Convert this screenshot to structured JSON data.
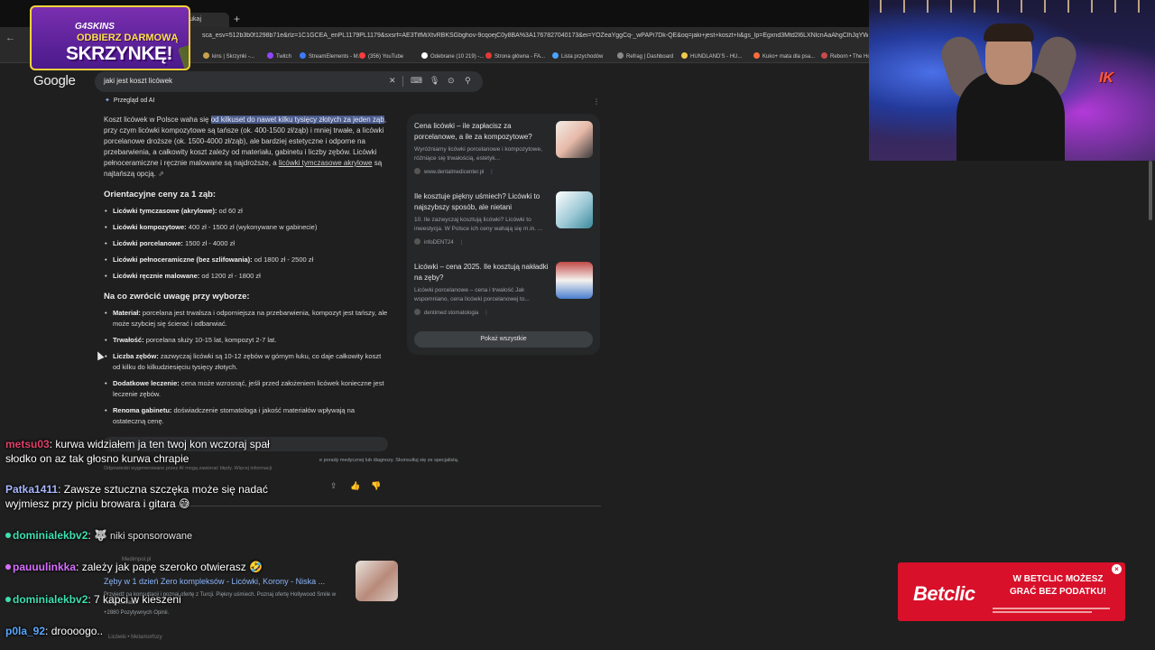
{
  "browser": {
    "tab_label": "Szukaj",
    "url": "sca_esv=512b3b0f1298b71e&rlz=1C1GCEA_enPL1179PL1179&sxsrf=AE3TifMiXtvRBKSGbghov-9cqoejC0y8BA%3A1767827040173&ei=YOZeaYggCq-_wPAPi7Dk-QE&oq=jaki+jest+koszt+li&gs_lp=Egxnd3Mtd2l6LXNlcnAaAhgClhJqYWtpIGplc3Qga29zenQgbGlj",
    "bookmarks": [
      "kins | Skrzynki -...",
      "Twitch",
      "StreamElements - M...",
      "(356) YouTube",
      "Odebrane (10 219) -...",
      "Strona główna - FA...",
      "Lista przychodów",
      "Refrag | Dashboard",
      "HUNDLAND'S - HU...",
      "Kuko+ mata dla psa...",
      "Reborn • The Ho"
    ]
  },
  "google": {
    "logo": "Google",
    "query": "jaki jest koszt licówek"
  },
  "ai_overview": {
    "label": "Przegląd od AI",
    "intro_1": "Koszt licówek w Polsce waha się ",
    "intro_hl": "od kilkuset do nawet kilku tysięcy złotych za jeden ząb",
    "intro_2": ", przy czym licówki kompozytowe są tańsze (ok. 400-1500 zł/ząb) i mniej trwałe, a licówki porcelanowe droższe (ok. 1500-4000 zł/ząb), ale bardziej estetyczne i odporne na przebarwienia, a całkowity koszt zależy od materiału, gabinetu i liczby zębów. Licówki pełnoceramiczne i ręcznie malowane są najdroższe, a ",
    "intro_u": "licówki tymczasowe akrylowe",
    "intro_3": " są najtańszą opcją.",
    "section1_title": "Orientacyjne ceny za 1 ząb:",
    "prices": [
      {
        "b": "Licówki tymczasowe (akrylowe):",
        "t": " od 60 zł"
      },
      {
        "b": "Licówki kompozytowe:",
        "t": " 400 zł - 1500 zł (wykonywane w gabinecie)"
      },
      {
        "b": "Licówki porcelanowe:",
        "t": " 1500 zł - 4000 zł"
      },
      {
        "b": "Licówki pełnoceramiczne (bez szlifowania):",
        "t": " od 1800 zł - 2500 zł"
      },
      {
        "b": "Licówki ręcznie malowane:",
        "t": " od 1200 zł - 1800 zł"
      }
    ],
    "section2_title": "Na co zwrócić uwagę przy wyborze:",
    "tips": [
      {
        "b": "Materiał:",
        "t": " porcelana jest trwalsza i odporniejsza na przebarwienia, kompozyt jest tańszy, ale może szybciej się ścierać i odbarwiać."
      },
      {
        "b": "Trwałość:",
        "t": " porcelana służy 10-15 lat, kompozyt 2-7 lat."
      },
      {
        "b": "Liczba zębów:",
        "t": " zazwyczaj licówki są 10-12 zębów w górnym łuku, co daje całkowity koszt od kilku do kilkudziesięciu tysięcy złotych."
      },
      {
        "b": "Dodatkowe leczenie:",
        "t": " cena może wzrosnąć, jeśli przed założeniem licówek konieczne jest leczenie zębów."
      },
      {
        "b": "Renoma gabinetu:",
        "t": " doświadczenie stomatologa i jakość materiałów wpływają na ostateczną cenę."
      }
    ],
    "disclaimer_1": "e porady medycznej lub diagnozy. Skonsultuj się ze specjalistą.",
    "disclaimer_2": "Odpowiedzi wygenerowane przez AI mogą zawierać błędy. Więcej informacji"
  },
  "sources": {
    "cards": [
      {
        "title": "Cena licówki – ile zapłacisz za porcelanowe, a ile za kompozytowe?",
        "snippet": "Wyróżniamy licówki porcelanowe i kompozytowe, różniące się trwałością, estetyk...",
        "site": "www.dentalmedicenter.pl"
      },
      {
        "title": "Ile kosztuje piękny uśmiech? Licówki to najszybszy sposób, ale nietani",
        "snippet": "10. Ile zazwyczaj kosztują licówki? Licówki to inwestycja. W Polsce ich ceny wahają się m.in. ...",
        "site": "infoDENT24"
      },
      {
        "title": "Licówki – cena 2025. Ile kosztują nakładki na zęby?",
        "snippet": "Licówki porcelanowe – cena i trwałość Jak wspomniano, cena licówki porcelanowej to...",
        "site": "dentimed stomatologia"
      }
    ],
    "show_all": "Pokaż wszystkie"
  },
  "ad": {
    "source": "Medimpol.pl",
    "title": "Zęby w 1 dzień Zero kompleksów - Licówki, Korony - Niska ...",
    "desc": "Przyjedź na konsultacji i poznaj ofertę z Turcji. Piękny uśmiech. Poznaj ofertę Hollywood Smile w Turcji Zobacz!",
    "reviews": "+2880 Pozytywnych Opinii.",
    "sub": "Licówki • Metamorfozy"
  },
  "chat": [
    {
      "user": "metsu03",
      "color": "#e0406a",
      "msg": "kurwa widziałem ja ten twoj kon wczoraj spał słodko on az tak głosno kurwa chrapie"
    },
    {
      "user": "Patka1411",
      "color": "#a9b8ff",
      "msg": "Zawsze sztuczna szczęka może się nadać wyjmiesz przy piciu browara i gitara 😅"
    },
    {
      "user": "dominialekbv2",
      "color": "#3fe0b0",
      "msg": "🐺"
    },
    {
      "user": "pauuulinkka",
      "color": "#d870ff",
      "msg": "zależy jak papę szeroko otwierasz 🤣"
    },
    {
      "user": "dominialekbv2",
      "color": "#3fe0b0",
      "msg": "7 kapci w kieszeni"
    },
    {
      "user": "p0la_92",
      "color": "#5aa8ff",
      "msg": "droooogo.."
    }
  ],
  "sponsored_label": "Wyniki sponsorowane",
  "promo": {
    "brand": "G4SKINS",
    "line1": "ODBIERZ DARMOWĄ",
    "line2": "SKRZYNKĘ!"
  },
  "webcam_logo": "IK",
  "betclic": {
    "logo": "Betclic",
    "headline": "W BETCLIC MOŻESZ GRAĆ BEZ PODATKU!",
    "close": "×"
  }
}
